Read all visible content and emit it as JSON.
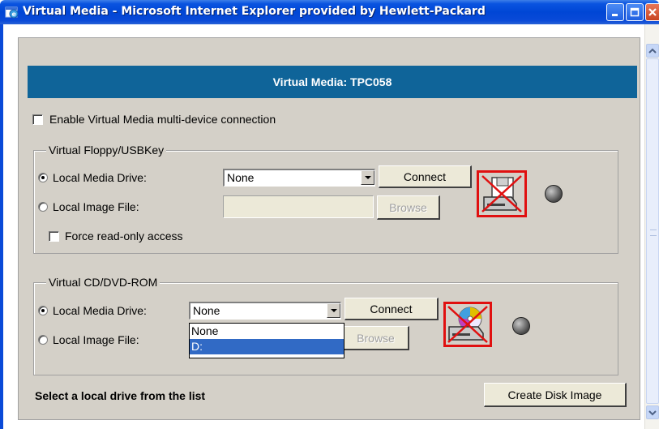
{
  "window": {
    "title": "Virtual Media - Microsoft Internet Explorer provided by Hewlett-Packard"
  },
  "banner": {
    "title": "Virtual Media: TPC058"
  },
  "multi_device": {
    "label": "Enable Virtual Media multi-device connection",
    "checked": false
  },
  "floppy": {
    "legend": "Virtual Floppy/USBKey",
    "local_drive_label": "Local Media Drive:",
    "local_image_label": "Local Image File:",
    "drive_value": "None",
    "connect_label": "Connect",
    "browse_label": "Browse",
    "readonly_label": "Force read-only access",
    "icon": "floppy-disconnected-icon"
  },
  "cdrom": {
    "legend": "Virtual CD/DVD-ROM",
    "local_drive_label": "Local Media Drive:",
    "local_image_label": "Local Image File:",
    "drive_value": "None",
    "connect_label": "Connect",
    "browse_label": "Browse",
    "options": [
      "None",
      "D:"
    ],
    "highlighted_option": "D:",
    "icon": "cdrom-disconnected-icon"
  },
  "status": {
    "message": "Select a local drive from the list"
  },
  "create_image_label": "Create Disk Image",
  "colors": {
    "banner": "#0f6499",
    "panel": "#d4d0c8",
    "disconnected_mark": "#e01010",
    "selection": "#316ac5"
  }
}
